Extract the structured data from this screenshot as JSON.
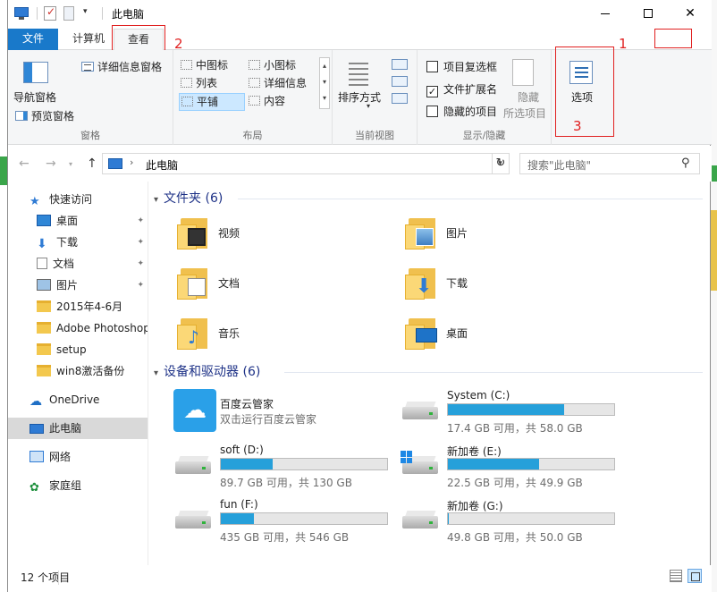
{
  "window": {
    "title": "此电脑",
    "minimize_icon": "minimize-icon",
    "maximize_icon": "maximize-icon",
    "close_glyph": "✕"
  },
  "quick_access_toolbar": {
    "dropdown_glyph": "▾"
  },
  "ribbon_tabs": {
    "file": "文件",
    "computer": "计算机",
    "view": "查看",
    "active": "查看"
  },
  "ribbon_controls": {
    "collapse_glyph": "^",
    "help_glyph": "?"
  },
  "annotations": {
    "one": "1",
    "two": "2",
    "three": "3",
    "color": "#e02020"
  },
  "ribbon": {
    "pane_group": {
      "label": "窗格",
      "navigation_pane": "导航窗格",
      "preview_pane": "预览窗格",
      "details_pane": "详细信息窗格"
    },
    "layout_group": {
      "label": "布局",
      "items": [
        {
          "label": "中图标",
          "selected": false
        },
        {
          "label": "小图标",
          "selected": false
        },
        {
          "label": "列表",
          "selected": false
        },
        {
          "label": "详细信息",
          "selected": false
        },
        {
          "label": "平铺",
          "selected": true
        },
        {
          "label": "内容",
          "selected": false
        }
      ],
      "scroll_up": "▴",
      "scroll_down": "▾",
      "scroll_more": "▾"
    },
    "current_view_group": {
      "label": "当前视图",
      "sort_by": "排序方式",
      "sort_caret": "▾"
    },
    "show_hide_group": {
      "label": "显示/隐藏",
      "item_checkboxes": {
        "label": "项目复选框",
        "checked": false
      },
      "file_name_extensions": {
        "label": "文件扩展名",
        "checked": true
      },
      "hidden_items": {
        "label": "隐藏的项目",
        "checked": false
      },
      "hide_selected_line1": "隐藏",
      "hide_selected_line2": "所选项目",
      "check_mark": "✓"
    },
    "options_group": {
      "options": "选项"
    }
  },
  "navigation": {
    "back_glyph": "←",
    "forward_glyph": "→",
    "recent_glyph": "▾",
    "up_glyph": "↑",
    "path_separator": "›",
    "path": "此电脑",
    "address_dropdown": "▾",
    "refresh_glyph": "↻",
    "search_placeholder": "搜索\"此电脑\"",
    "search_glyph": "⚲"
  },
  "sidebar": {
    "quick_access": "快速访问",
    "items": [
      {
        "label": "桌面",
        "icon": "desktop-icon",
        "pinned": true
      },
      {
        "label": "下载",
        "icon": "download-icon",
        "pinned": true
      },
      {
        "label": "文档",
        "icon": "document-icon",
        "pinned": true
      },
      {
        "label": "图片",
        "icon": "pictures-icon",
        "pinned": true
      },
      {
        "label": "2015年4-6月",
        "icon": "folder-icon",
        "pinned": false
      },
      {
        "label": "Adobe Photoshop",
        "icon": "folder-icon",
        "pinned": false
      },
      {
        "label": "setup",
        "icon": "folder-icon",
        "pinned": false
      },
      {
        "label": "win8激活备份",
        "icon": "folder-icon",
        "pinned": false
      }
    ],
    "onedrive": "OneDrive",
    "this_pc": "此电脑",
    "network": "网络",
    "homegroup": "家庭组",
    "pin_glyph": "📌"
  },
  "content": {
    "folders_header": "文件夹 (6)",
    "folders": [
      {
        "label": "视频",
        "icon": "video-folder-icon"
      },
      {
        "label": "图片",
        "icon": "pictures-folder-icon"
      },
      {
        "label": "文档",
        "icon": "documents-folder-icon"
      },
      {
        "label": "下载",
        "icon": "downloads-folder-icon"
      },
      {
        "label": "音乐",
        "icon": "music-folder-icon"
      },
      {
        "label": "桌面",
        "icon": "desktop-folder-icon"
      }
    ],
    "devices_header": "设备和驱动器 (6)",
    "baidu": {
      "name": "百度云管家",
      "desc": "双击运行百度云管家",
      "icon": "baidu-cloud-icon"
    },
    "drives": [
      {
        "name": "System (C:)",
        "info": "17.4 GB 可用，共 58.0 GB",
        "used_fraction": 0.7,
        "icon": "system-drive-icon"
      },
      {
        "name": "soft (D:)",
        "info": "89.7 GB 可用，共 130 GB",
        "used_fraction": 0.31,
        "icon": "hard-drive-icon"
      },
      {
        "name": "新加卷 (E:)",
        "info": "22.5 GB 可用，共 49.9 GB",
        "used_fraction": 0.55,
        "icon": "windows-drive-icon"
      },
      {
        "name": "fun (F:)",
        "info": "435 GB 可用，共 546 GB",
        "used_fraction": 0.2,
        "icon": "hard-drive-icon"
      },
      {
        "name": "新加卷 (G:)",
        "info": "49.8 GB 可用，共 50.0 GB",
        "used_fraction": 0.004,
        "icon": "hard-drive-icon"
      }
    ],
    "expand_glyph": "▾",
    "accent_color": "#26a0da"
  },
  "status": {
    "count": "12 个项目"
  }
}
